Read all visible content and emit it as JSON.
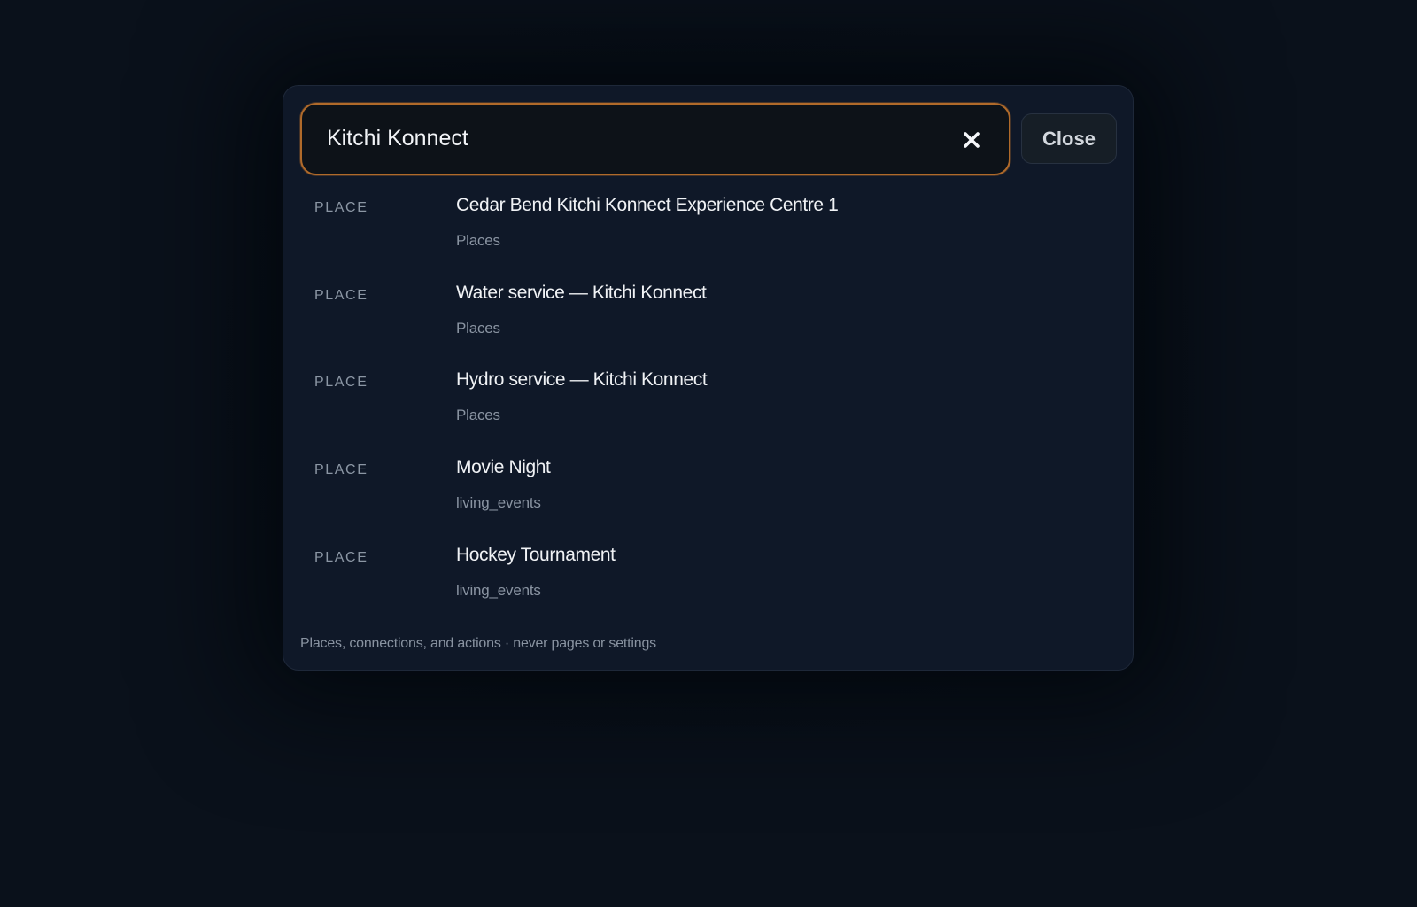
{
  "search": {
    "value": "Kitchi Konnect",
    "clear_icon": "close-x-icon"
  },
  "close_label": "Close",
  "results": [
    {
      "type": "PLACE",
      "title": "Cedar Bend Kitchi Konnect Experience Centre 1",
      "subtitle": "Places"
    },
    {
      "type": "PLACE",
      "title": "Water service — Kitchi Konnect",
      "subtitle": "Places"
    },
    {
      "type": "PLACE",
      "title": "Hydro service — Kitchi Konnect",
      "subtitle": "Places"
    },
    {
      "type": "PLACE",
      "title": "Movie Night",
      "subtitle": "living_events"
    },
    {
      "type": "PLACE",
      "title": "Hockey Tournament",
      "subtitle": "living_events"
    }
  ],
  "footer": "Places, connections, and actions · never pages or settings",
  "colors": {
    "background": "#09101a",
    "panel": "#0f1828",
    "accent_border": "#b06a2a",
    "title_text": "#f0f2f5",
    "muted_text": "#8a94a2"
  }
}
